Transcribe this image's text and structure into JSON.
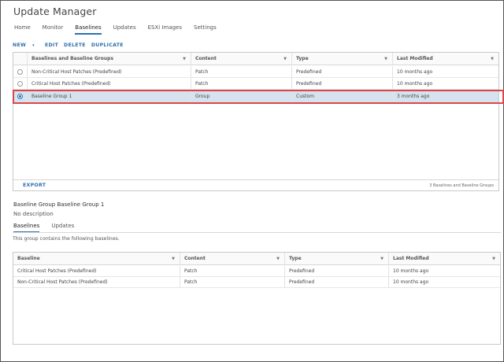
{
  "app": {
    "title": "Update Manager"
  },
  "nav": {
    "tabs": [
      "Home",
      "Monitor",
      "Baselines",
      "Updates",
      "ESXi Images",
      "Settings"
    ],
    "active": "Baselines"
  },
  "actions": {
    "new": "NEW",
    "edit": "EDIT",
    "delete": "DELETE",
    "duplicate": "DUPLICATE"
  },
  "baselines_grid": {
    "columns": [
      "Baselines and Baseline Groups",
      "Content",
      "Type",
      "Last Modified"
    ],
    "rows": [
      {
        "name": "Non-Critical Host Patches (Predefined)",
        "content": "Patch",
        "type": "Predefined",
        "modified": "10 months ago",
        "selected": false
      },
      {
        "name": "Critical Host Patches (Predefined)",
        "content": "Patch",
        "type": "Predefined",
        "modified": "10 months ago",
        "selected": false
      },
      {
        "name": "Baseline Group 1",
        "content": "Group",
        "type": "Custom",
        "modified": "3 months ago",
        "selected": true
      }
    ],
    "export": "EXPORT",
    "count": "3 Baselines and Baseline Groups"
  },
  "details": {
    "title": "Baseline Group Baseline Group 1",
    "description": "No description",
    "tabs": [
      "Baselines",
      "Updates"
    ],
    "active_tab": "Baselines",
    "note": "This group contains the following baselines."
  },
  "group_grid": {
    "columns": [
      "Baseline",
      "Content",
      "Type",
      "Last Modified"
    ],
    "rows": [
      {
        "name": "Critical Host Patches (Predefined)",
        "content": "Patch",
        "type": "Predefined",
        "modified": "10 months ago"
      },
      {
        "name": "Non-Critical Host Patches (Predefined)",
        "content": "Patch",
        "type": "Predefined",
        "modified": "10 months ago"
      }
    ]
  },
  "colors": {
    "accent": "#2f6fad",
    "selected_row": "#d6e3ee",
    "highlight_border": "#d9474a"
  }
}
